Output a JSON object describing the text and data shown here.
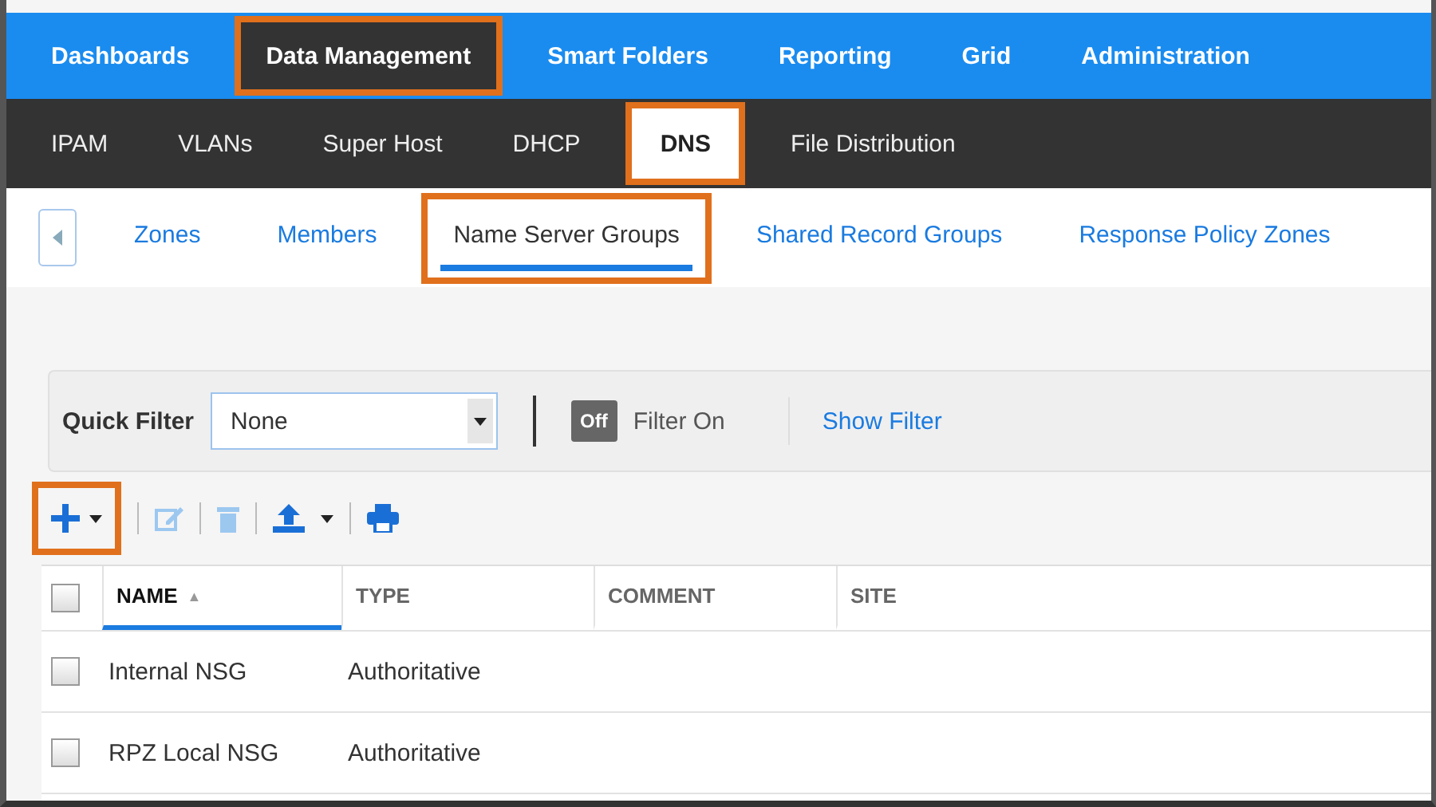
{
  "main_nav": [
    {
      "label": "Dashboards",
      "selected": false,
      "highlighted": false
    },
    {
      "label": "Data Management",
      "selected": true,
      "highlighted": true
    },
    {
      "label": "Smart Folders",
      "selected": false,
      "highlighted": false
    },
    {
      "label": "Reporting",
      "selected": false,
      "highlighted": false
    },
    {
      "label": "Grid",
      "selected": false,
      "highlighted": false
    },
    {
      "label": "Administration",
      "selected": false,
      "highlighted": false
    }
  ],
  "sub_nav": [
    {
      "label": "IPAM",
      "selected": false,
      "highlighted": false
    },
    {
      "label": "VLANs",
      "selected": false,
      "highlighted": false
    },
    {
      "label": "Super Host",
      "selected": false,
      "highlighted": false
    },
    {
      "label": "DHCP",
      "selected": false,
      "highlighted": false
    },
    {
      "label": "DNS",
      "selected": true,
      "highlighted": true
    },
    {
      "label": "File Distribution",
      "selected": false,
      "highlighted": false
    }
  ],
  "tabs": [
    {
      "label": "Zones",
      "selected": false,
      "highlighted": false
    },
    {
      "label": "Members",
      "selected": false,
      "highlighted": false
    },
    {
      "label": "Name Server Groups",
      "selected": true,
      "highlighted": true
    },
    {
      "label": "Shared Record Groups",
      "selected": false,
      "highlighted": false
    },
    {
      "label": "Response Policy Zones",
      "selected": false,
      "highlighted": false
    }
  ],
  "filter_bar": {
    "label": "Quick Filter",
    "value": "None",
    "toggle": {
      "text": "Off",
      "on": false
    },
    "toggle_label": "Filter On",
    "link": "Show Filter"
  },
  "toolbar": {
    "add_highlighted": true
  },
  "table": {
    "sort_indicator": "▲",
    "all_checked": false,
    "columns": [
      {
        "label": "NAME",
        "sorted": true
      },
      {
        "label": "TYPE",
        "sorted": false
      },
      {
        "label": "COMMENT",
        "sorted": false
      },
      {
        "label": "SITE",
        "sorted": false
      }
    ],
    "rows": [
      {
        "name": "Internal NSG",
        "type": "Authoritative",
        "checked": false
      },
      {
        "name": "RPZ Local NSG",
        "type": "Authoritative",
        "checked": false
      }
    ]
  }
}
